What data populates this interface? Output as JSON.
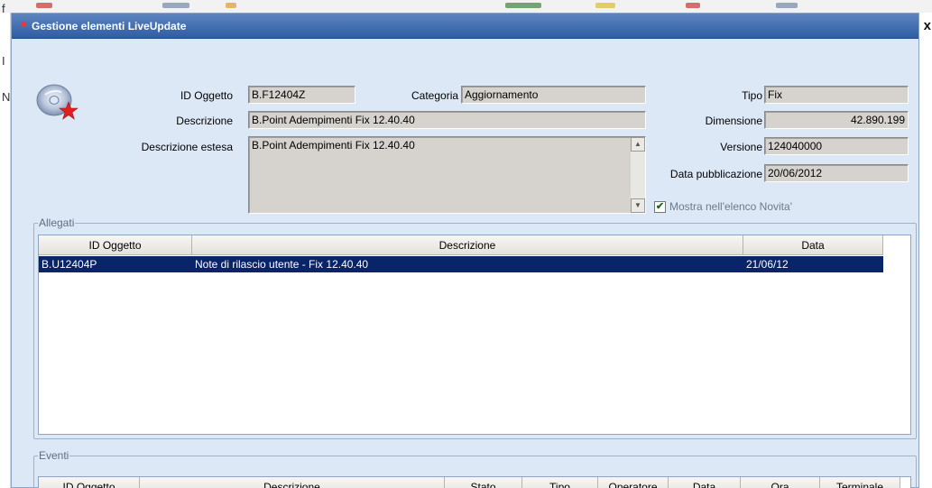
{
  "window": {
    "title": "Gestione elementi LiveUpdate",
    "close_glyph": "x"
  },
  "background_glyphs": [
    "f",
    "I",
    "N"
  ],
  "icons": {
    "object_icon": "cd-star-icon",
    "title_dot": "app-dot-icon",
    "scroll_up": "▲",
    "scroll_down": "▼",
    "check_glyph": "✔"
  },
  "form": {
    "id_oggetto_label": "ID Oggetto",
    "id_oggetto_value": "B.F12404Z",
    "categoria_label": "Categoria",
    "categoria_value": "Aggiornamento",
    "tipo_label": "Tipo",
    "tipo_value": "Fix",
    "descrizione_label": "Descrizione",
    "descrizione_value": "B.Point Adempimenti Fix 12.40.40",
    "dimensione_label": "Dimensione",
    "dimensione_value": "42.890.199",
    "descrizione_estesa_label": "Descrizione estesa",
    "descrizione_estesa_value": "B.Point Adempimenti Fix 12.40.40",
    "versione_label": "Versione",
    "versione_value": "124040000",
    "data_pubblicazione_label": "Data pubblicazione",
    "data_pubblicazione_value": "20/06/2012",
    "mostra_novita_label": "Mostra nell'elenco Novita'",
    "mostra_novita_checked": true
  },
  "allegati": {
    "title": "Allegati",
    "columns": [
      "ID Oggetto",
      "Descrizione",
      "Data"
    ],
    "rows": [
      {
        "id": "B.U12404P",
        "descrizione": "Note di rilascio utente - Fix 12.40.40",
        "data": "21/06/12"
      }
    ]
  },
  "eventi": {
    "title": "Eventi",
    "columns": [
      "ID Oggetto",
      "Descrizione",
      "Stato",
      "Tipo",
      "Operatore",
      "Data",
      "Ora",
      "Terminale"
    ]
  },
  "colors": {
    "title_bar": "#2f5ea3",
    "dialog_bg": "#dde8f6",
    "selection": "#0a246a",
    "field_bg": "#d6d3ce"
  }
}
